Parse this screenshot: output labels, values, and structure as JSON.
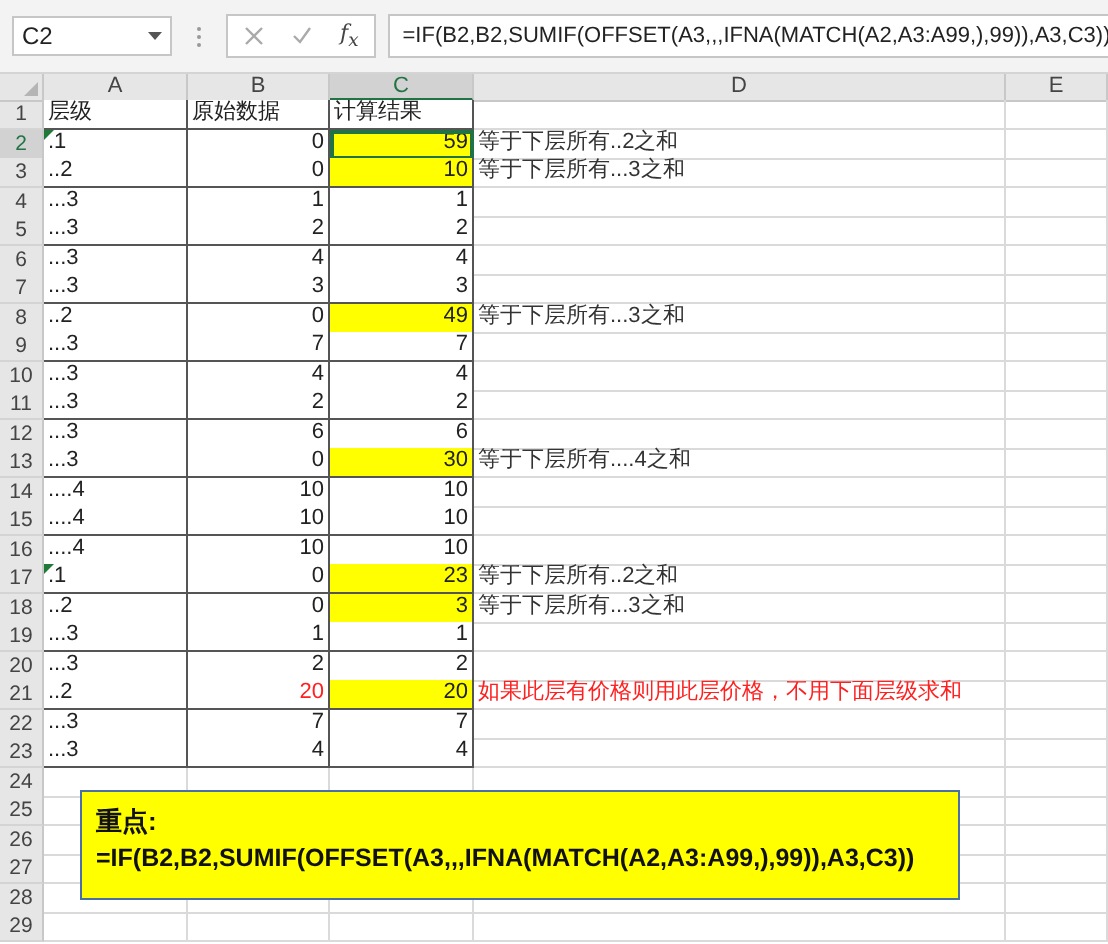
{
  "formula_bar": {
    "name_box": "C2",
    "function_button": "f$_{x}$",
    "formula": "=IF(B2,B2,SUMIF(OFFSET(A3,,,IFNA(MATCH(A2,A3:A99,),99)),A3,C3))"
  },
  "columns": [
    {
      "label": "A",
      "selected": false
    },
    {
      "label": "B",
      "selected": false
    },
    {
      "label": "C",
      "selected": true
    },
    {
      "label": "D",
      "selected": false
    },
    {
      "label": "E",
      "selected": false
    }
  ],
  "header_row": {
    "number": "1",
    "cells": [
      "层级",
      "原始数据",
      "计算结果"
    ]
  },
  "rows": [
    {
      "number": "2",
      "level": ".1",
      "raw": "0",
      "result": "59",
      "highlighted": true,
      "selected": true,
      "warning": true,
      "alert": false,
      "note": "等于下层所有..2之和"
    },
    {
      "number": "3",
      "level": "..2",
      "raw": "0",
      "result": "10",
      "highlighted": true,
      "selected": false,
      "warning": false,
      "alert": false,
      "note": "等于下层所有...3之和"
    },
    {
      "number": "4",
      "level": "...3",
      "raw": "1",
      "result": "1",
      "highlighted": false,
      "selected": false,
      "warning": false,
      "alert": false
    },
    {
      "number": "5",
      "level": "...3",
      "raw": "2",
      "result": "2",
      "highlighted": false,
      "selected": false,
      "warning": false,
      "alert": false
    },
    {
      "number": "6",
      "level": "...3",
      "raw": "4",
      "result": "4",
      "highlighted": false,
      "selected": false,
      "warning": false,
      "alert": false
    },
    {
      "number": "7",
      "level": "...3",
      "raw": "3",
      "result": "3",
      "highlighted": false,
      "selected": false,
      "warning": false,
      "alert": false
    },
    {
      "number": "8",
      "level": "..2",
      "raw": "0",
      "result": "49",
      "highlighted": true,
      "selected": false,
      "warning": false,
      "alert": false,
      "note": "等于下层所有...3之和"
    },
    {
      "number": "9",
      "level": "...3",
      "raw": "7",
      "result": "7",
      "highlighted": false,
      "selected": false,
      "warning": false,
      "alert": false
    },
    {
      "number": "10",
      "level": "...3",
      "raw": "4",
      "result": "4",
      "highlighted": false,
      "selected": false,
      "warning": false,
      "alert": false
    },
    {
      "number": "11",
      "level": "...3",
      "raw": "2",
      "result": "2",
      "highlighted": false,
      "selected": false,
      "warning": false,
      "alert": false
    },
    {
      "number": "12",
      "level": "...3",
      "raw": "6",
      "result": "6",
      "highlighted": false,
      "selected": false,
      "warning": false,
      "alert": false
    },
    {
      "number": "13",
      "level": "...3",
      "raw": "0",
      "result": "30",
      "highlighted": true,
      "selected": false,
      "warning": false,
      "alert": false,
      "note": "等于下层所有....4之和"
    },
    {
      "number": "14",
      "level": "....4",
      "raw": "10",
      "result": "10",
      "highlighted": false,
      "selected": false,
      "warning": false,
      "alert": false
    },
    {
      "number": "15",
      "level": "....4",
      "raw": "10",
      "result": "10",
      "highlighted": false,
      "selected": false,
      "warning": false,
      "alert": false
    },
    {
      "number": "16",
      "level": "....4",
      "raw": "10",
      "result": "10",
      "highlighted": false,
      "selected": false,
      "warning": false,
      "alert": false
    },
    {
      "number": "17",
      "level": ".1",
      "raw": "0",
      "result": "23",
      "highlighted": true,
      "selected": false,
      "warning": true,
      "alert": false,
      "note": "等于下层所有..2之和"
    },
    {
      "number": "18",
      "level": "..2",
      "raw": "0",
      "result": "3",
      "highlighted": true,
      "selected": false,
      "warning": false,
      "alert": false,
      "note": "等于下层所有...3之和"
    },
    {
      "number": "19",
      "level": "...3",
      "raw": "1",
      "result": "1",
      "highlighted": false,
      "selected": false,
      "warning": false,
      "alert": false
    },
    {
      "number": "20",
      "level": "...3",
      "raw": "2",
      "result": "2",
      "highlighted": false,
      "selected": false,
      "warning": false,
      "alert": false
    },
    {
      "number": "21",
      "level": "..2",
      "raw": "20",
      "result": "20",
      "highlighted": true,
      "selected": false,
      "warning": false,
      "alert": true,
      "note": "如果此层有价格则用此层价格，不用下面层级求和"
    },
    {
      "number": "22",
      "level": "...3",
      "raw": "7",
      "result": "7",
      "highlighted": false,
      "selected": false,
      "warning": false,
      "alert": false
    },
    {
      "number": "23",
      "level": "...3",
      "raw": "4",
      "result": "4",
      "highlighted": false,
      "selected": false,
      "warning": false,
      "alert": false
    }
  ],
  "empty_rows": [
    "24",
    "25",
    "26",
    "27",
    "28",
    "29"
  ],
  "callout": {
    "title": "重点:",
    "formula": "=IF(B2,B2,SUMIF(OFFSET(A3,,,IFNA(MATCH(A2,A3:A99,),99)),A3,C3))"
  }
}
